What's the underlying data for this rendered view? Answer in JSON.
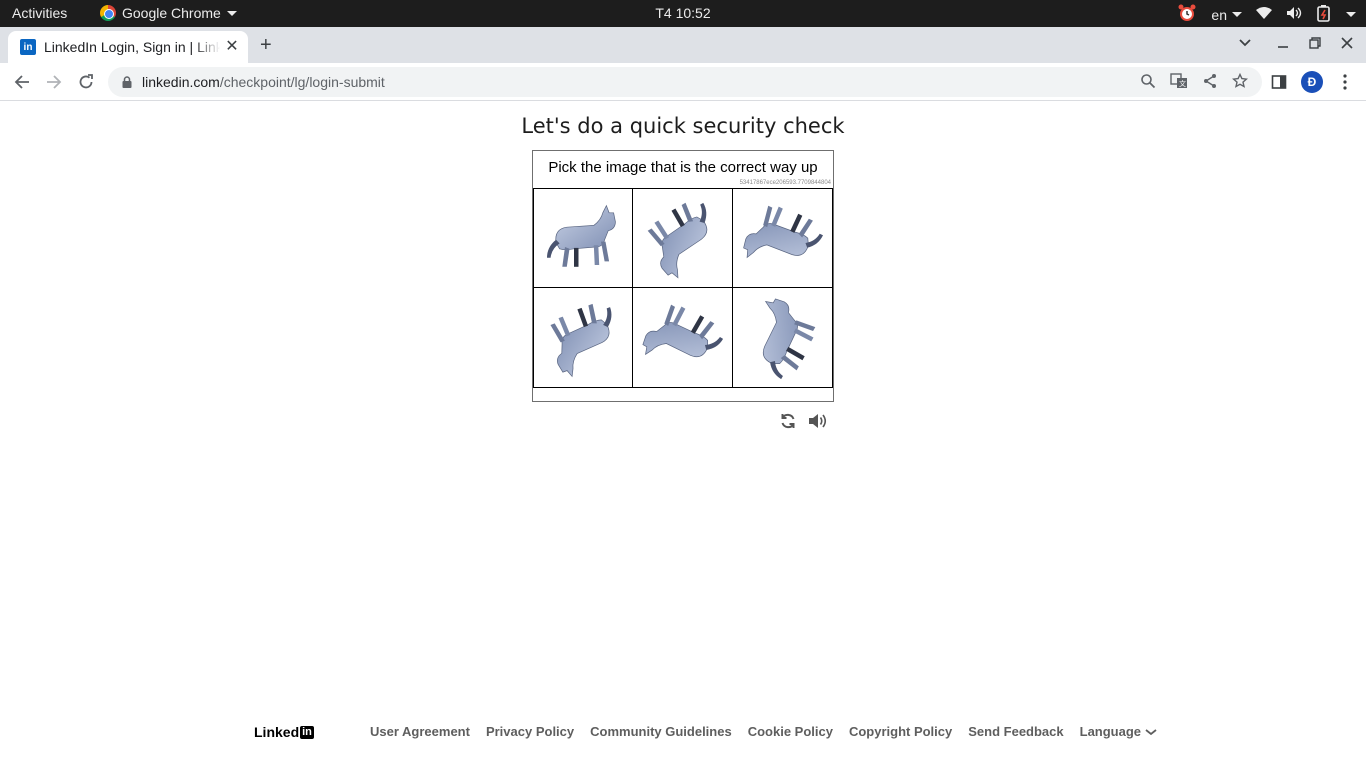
{
  "system_bar": {
    "activities": "Activities",
    "app_name": "Google Chrome",
    "clock": "T4 10:52",
    "lang": "en"
  },
  "browser": {
    "tab_title": "LinkedIn Login, Sign in | LinkedIn",
    "url_domain": "linkedin.com",
    "url_path": "/checkpoint/lg/login-submit",
    "profile_initial": "Đ"
  },
  "page": {
    "title": "Let's do a quick security check",
    "captcha": {
      "prompt": "Pick the image that is the correct way up",
      "token": "53417867ece206593.7709844804",
      "images": [
        {
          "label": "dog-image",
          "rotation": 0
        },
        {
          "label": "dog-image",
          "rotation": 150
        },
        {
          "label": "dog-image",
          "rotation": 205
        },
        {
          "label": "dog-image",
          "rotation": 160
        },
        {
          "label": "dog-image",
          "rotation": 210
        },
        {
          "label": "dog-image",
          "rotation": 300
        }
      ]
    }
  },
  "footer": {
    "logo_text": "Linked",
    "logo_in": "in",
    "links": [
      "User Agreement",
      "Privacy Policy",
      "Community Guidelines",
      "Cookie Policy",
      "Copyright Policy",
      "Send Feedback"
    ],
    "language": "Language"
  },
  "colors": {
    "linkedin_blue": "#0a66c2",
    "topbar": "#1d1d1d",
    "tabstrip": "#dee1e6"
  }
}
